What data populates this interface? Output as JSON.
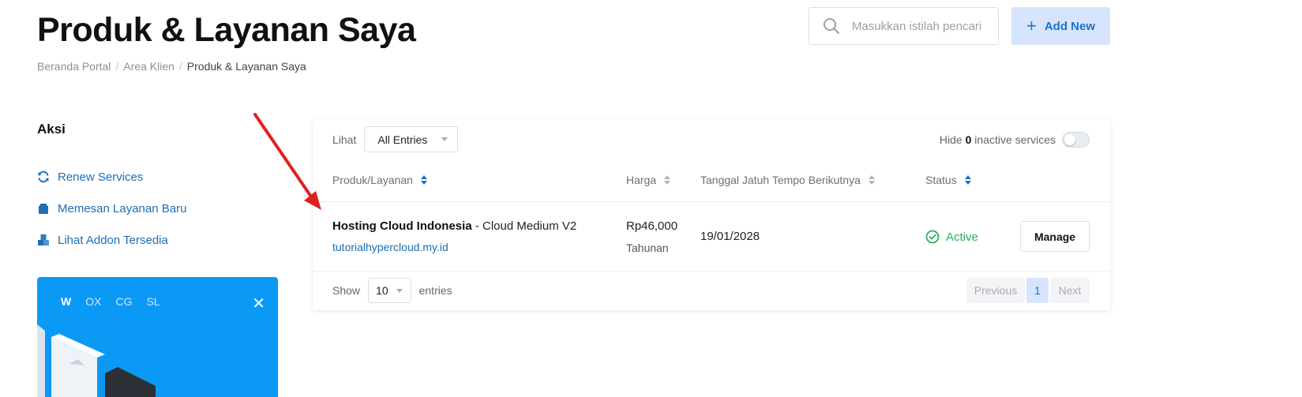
{
  "header": {
    "title": "Produk & Layanan Saya",
    "breadcrumb": [
      "Beranda Portal",
      "Area Klien",
      "Produk & Layanan Saya"
    ],
    "breadcrumb_separator": "/",
    "search_placeholder": "Masukkan istilah pencari",
    "add_new_label": "Add New",
    "add_new_icon": "plus-icon"
  },
  "sidebar": {
    "title": "Aksi",
    "items": [
      {
        "label": "Renew Services",
        "icon": "sync-icon"
      },
      {
        "label": "Memesan Layanan Baru",
        "icon": "shopping-bag-icon"
      },
      {
        "label": "Lihat Addon Tersedia",
        "icon": "cubes-icon"
      }
    ],
    "promo": {
      "tabs": [
        "W",
        "OX",
        "CG",
        "SL"
      ],
      "active_tab": "W",
      "close_label": "✕",
      "bg_color": "#0a9af5"
    }
  },
  "table": {
    "filter_label": "Lihat",
    "filter_value": "All Entries",
    "hide_prefix": "Hide",
    "hide_count": "0",
    "hide_suffix": "inactive services",
    "columns": [
      "Produk/Layanan",
      "Harga",
      "Tanggal Jatuh Tempo Berikutnya",
      "Status"
    ],
    "rows": [
      {
        "product": "Hosting Cloud Indonesia",
        "plan": " - Cloud Medium V2",
        "domain": "tutorialhypercloud.my.id",
        "price": "Rp46,000",
        "cycle": "Tahunan",
        "due_date": "19/01/2028",
        "status": "Active",
        "action": "Manage"
      }
    ],
    "show_label": "Show",
    "show_value": "10",
    "entries_label": "entries",
    "pagination": {
      "previous": "Previous",
      "current": "1",
      "next": "Next"
    }
  },
  "colors": {
    "accent": "#1a73c9",
    "link": "#1a6fb8",
    "active_status": "#27b358",
    "annotation_arrow": "#e02020"
  }
}
